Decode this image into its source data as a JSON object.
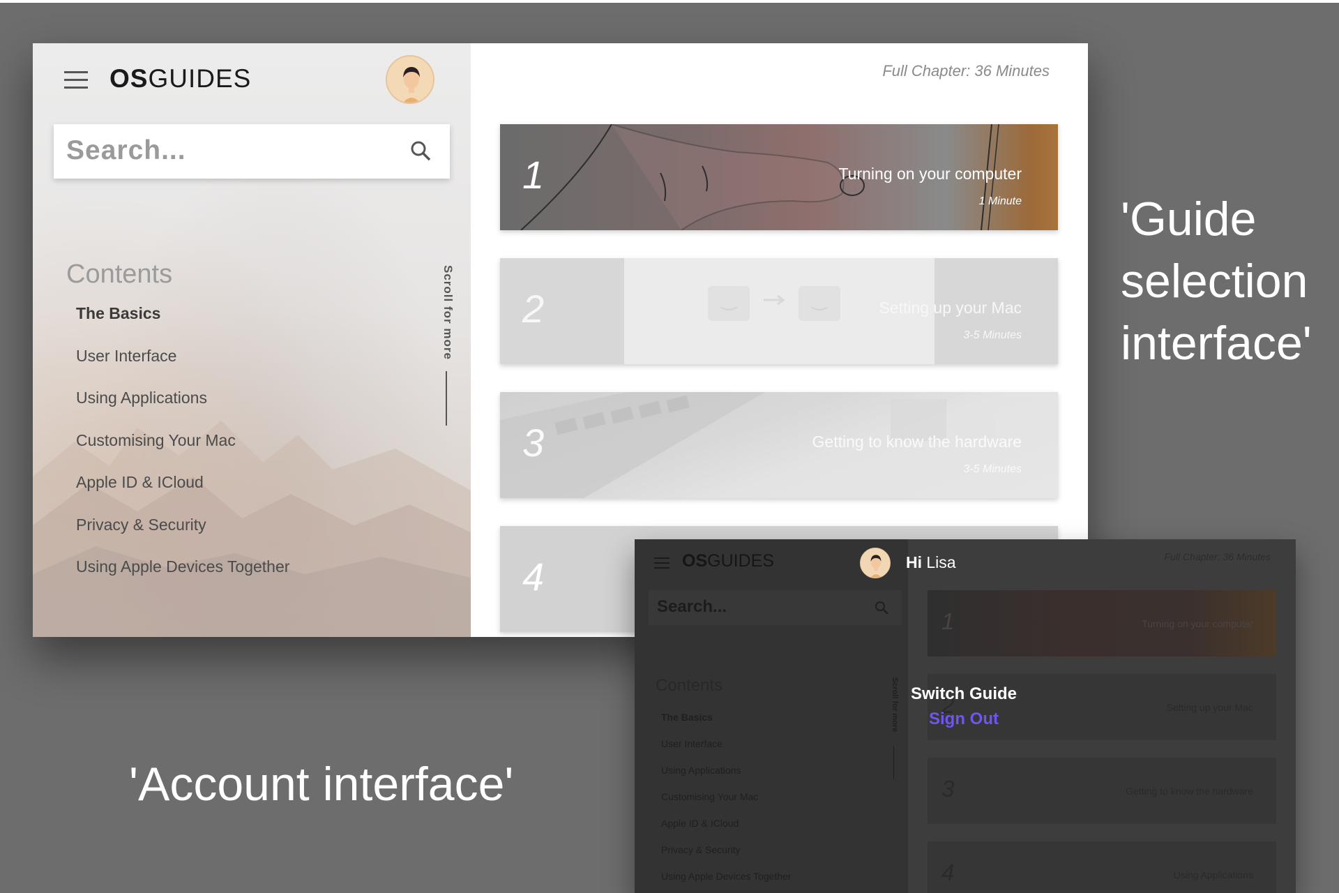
{
  "captions": {
    "guide": "'Guide selection interface'",
    "account": "'Account interface'"
  },
  "guide_ui": {
    "brand": {
      "bold": "OS",
      "regular": "GUIDES"
    },
    "search": {
      "placeholder": "Search..."
    },
    "contents_title": "Contents",
    "scroll_hint": "Scroll for more",
    "toc": [
      "The Basics",
      "User Interface",
      "Using Applications",
      "Customising Your Mac",
      "Apple ID & ICloud",
      "Privacy & Security",
      "Using Apple Devices Together"
    ],
    "chapter_time": "Full Chapter: 36 Minutes",
    "cards": [
      {
        "num": "1",
        "title": "Turning on your computer",
        "duration": "1 Minute"
      },
      {
        "num": "2",
        "title": "Setting up your Mac",
        "duration": "3-5 Minutes"
      },
      {
        "num": "3",
        "title": "Getting to know the hardware",
        "duration": "3-5 Minutes"
      },
      {
        "num": "4",
        "title": "",
        "duration": ""
      }
    ]
  },
  "account_ui": {
    "brand": {
      "bold": "OS",
      "regular": "GUIDES"
    },
    "search": {
      "placeholder": "Search..."
    },
    "contents_title": "Contents",
    "scroll_hint": "Scroll for more",
    "toc": [
      "The Basics",
      "User Interface",
      "Using Applications",
      "Customising Your Mac",
      "Apple ID & ICloud",
      "Privacy & Security",
      "Using Apple Devices Together"
    ],
    "chapter_time": "Full Chapter: 36 Minutes",
    "greeting": {
      "hi": "Hi",
      "name": "Lisa"
    },
    "menu": {
      "switch_guide": "Switch Guide",
      "sign_out": "Sign Out"
    },
    "cards": [
      {
        "num": "1",
        "title": "Turning on your computer"
      },
      {
        "num": "2",
        "title": "Setting up your Mac"
      },
      {
        "num": "3",
        "title": "Getting to know the hardware"
      },
      {
        "num": "4",
        "title": "Using Applications"
      }
    ]
  },
  "colors": {
    "background": "#6d6d6d",
    "accent_signout": "#6d56f5"
  },
  "icons": [
    "hamburger-icon",
    "search-icon",
    "avatar"
  ]
}
